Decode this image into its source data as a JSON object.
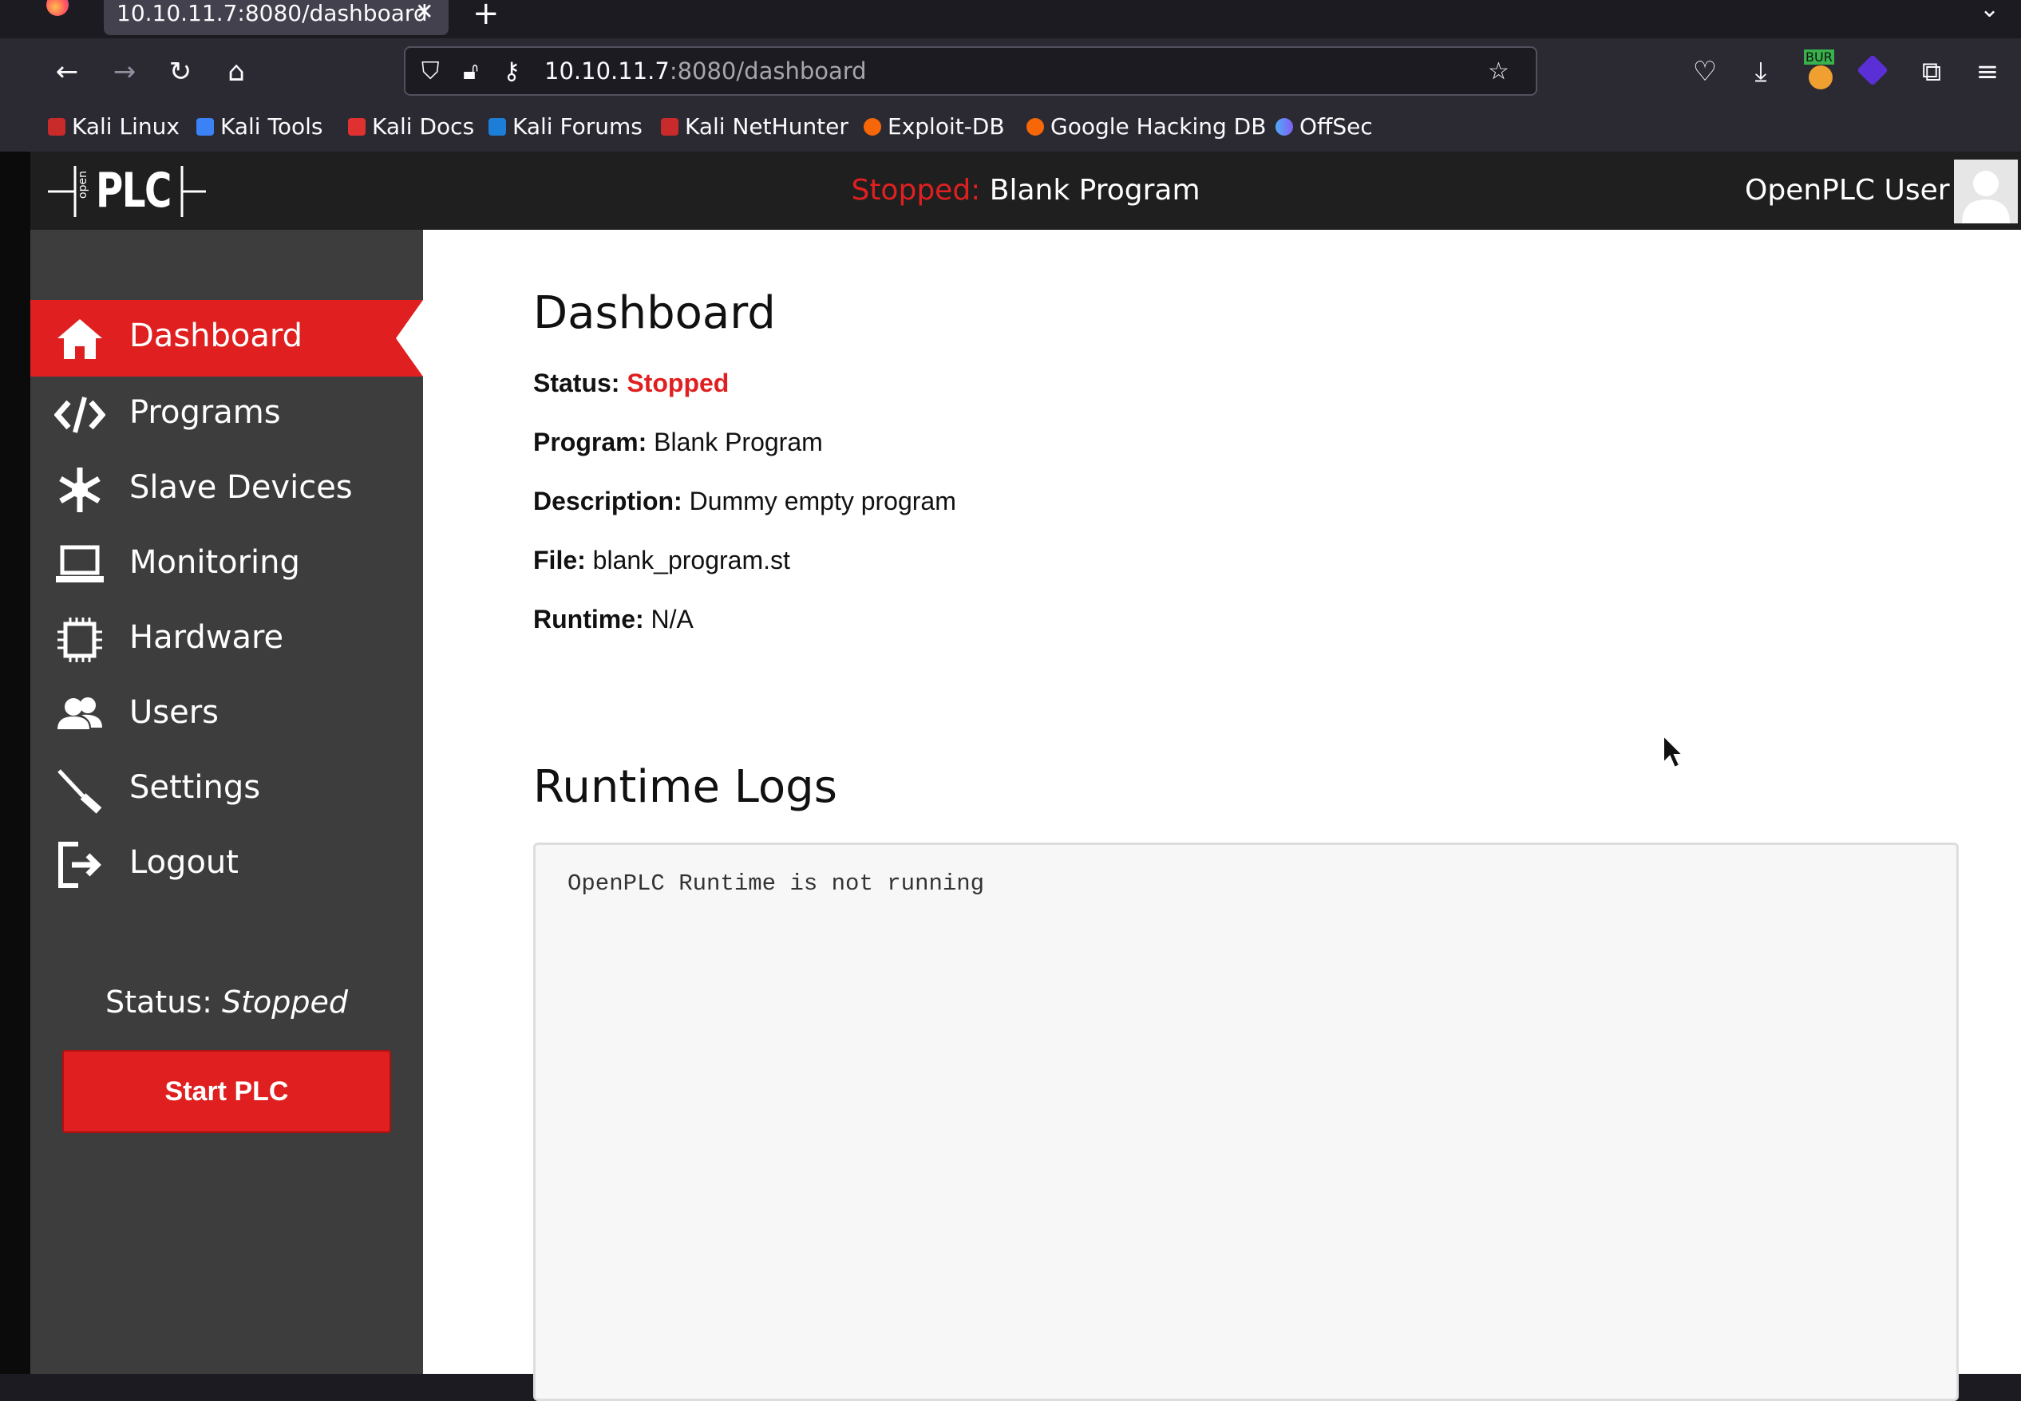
{
  "browser": {
    "tab_title": "10.10.11.7:8080/dashboard",
    "url_host": "10.10.11.7",
    "url_path": ":8080/dashboard",
    "bookmarks": [
      "Kali Linux",
      "Kali Tools",
      "Kali Docs",
      "Kali Forums",
      "Kali NetHunter",
      "Exploit-DB",
      "Google Hacking DB",
      "OffSec"
    ],
    "burp_badge": "BUR"
  },
  "header": {
    "status_word": "Stopped:",
    "program_name": "Blank Program",
    "user": "OpenPLC User",
    "logo_text": "PLC",
    "logo_small": "open"
  },
  "sidebar": {
    "items": [
      {
        "label": "Dashboard",
        "icon": "home-icon"
      },
      {
        "label": "Programs",
        "icon": "code-icon"
      },
      {
        "label": "Slave Devices",
        "icon": "snowflake-icon"
      },
      {
        "label": "Monitoring",
        "icon": "laptop-icon"
      },
      {
        "label": "Hardware",
        "icon": "chip-icon"
      },
      {
        "label": "Users",
        "icon": "users-icon"
      },
      {
        "label": "Settings",
        "icon": "screwdriver-icon"
      },
      {
        "label": "Logout",
        "icon": "logout-icon"
      }
    ],
    "status_label": "Status:",
    "status_value": "Stopped",
    "start_button": "Start PLC"
  },
  "dashboard": {
    "title": "Dashboard",
    "status_label": "Status:",
    "status_value": "Stopped",
    "program_label": "Program:",
    "program_value": "Blank Program",
    "description_label": "Description:",
    "description_value": "Dummy empty program",
    "file_label": "File:",
    "file_value": "blank_program.st",
    "runtime_label": "Runtime:",
    "runtime_value": "N/A"
  },
  "logs": {
    "title": "Runtime Logs",
    "content": "OpenPLC Runtime is not running"
  },
  "colors": {
    "accent_red": "#e02020",
    "sidebar_bg": "#3d3d3d",
    "topbar_bg": "#1f1f1f"
  }
}
